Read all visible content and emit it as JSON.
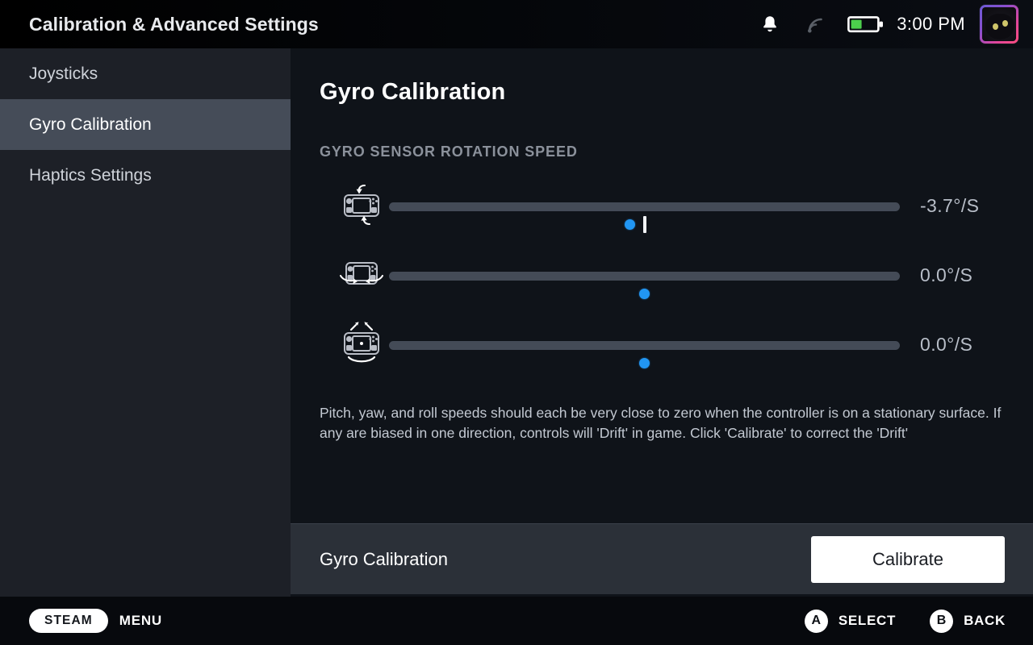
{
  "topbar": {
    "title": "Calibration & Advanced Settings",
    "clock": "3:00 PM",
    "icons": {
      "notification": "bell-icon",
      "wifi": "wifi-icon",
      "battery": "battery-icon",
      "avatar": "avatar"
    },
    "battery_level_percent": 40,
    "accent_color": "#2196f3"
  },
  "sidebar": {
    "items": [
      {
        "label": "Joysticks",
        "selected": false
      },
      {
        "label": "Gyro Calibration",
        "selected": true
      },
      {
        "label": "Haptics Settings",
        "selected": false
      }
    ]
  },
  "main": {
    "page_title": "Gyro Calibration",
    "section_label": "GYRO SENSOR ROTATION SPEED",
    "axes": [
      {
        "name": "pitch",
        "icon": "gyro-pitch-icon",
        "value": "-3.7°/S",
        "knob_percent": 47.1,
        "tick_percent": 50,
        "show_tick": true
      },
      {
        "name": "yaw",
        "icon": "gyro-yaw-icon",
        "value": "0.0°/S",
        "knob_percent": 50,
        "tick_percent": 50,
        "show_tick": false
      },
      {
        "name": "roll",
        "icon": "gyro-roll-icon",
        "value": "0.0°/S",
        "knob_percent": 50,
        "tick_percent": 50,
        "show_tick": false
      }
    ],
    "description": "Pitch, yaw, and roll speeds should each be very close to zero when the controller is on a stationary surface. If any are biased in one direction, controls will 'Drift' in game. Click 'Calibrate' to correct the 'Drift'",
    "action": {
      "label": "Gyro Calibration",
      "button_label": "Calibrate"
    }
  },
  "footer": {
    "steam_label": "STEAM",
    "menu_label": "MENU",
    "hints": [
      {
        "glyph": "A",
        "label": "SELECT"
      },
      {
        "glyph": "B",
        "label": "BACK"
      }
    ]
  }
}
